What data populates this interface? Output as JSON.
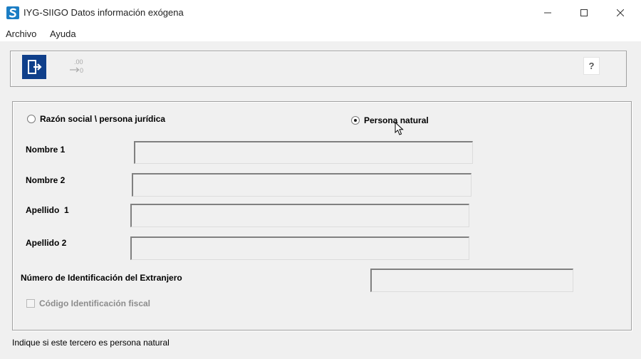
{
  "window": {
    "title": "IYG-SIIGO Datos información exógena"
  },
  "menu": {
    "archivo": "Archivo",
    "ayuda": "Ayuda"
  },
  "toolbar": {
    "help": "?",
    "decimal_top": ".00",
    "decimal_bottom": "0"
  },
  "form": {
    "radio_juridica": "Razón social \\ persona jurídica",
    "radio_natural": "Persona natural",
    "selected_radio": "natural",
    "nombre1_label": "Nombre 1",
    "nombre1_value": "",
    "nombre2_label": "Nombre 2",
    "nombre2_value": "",
    "apellido1_label": "Apellido  1",
    "apellido1_value": "",
    "apellido2_label": "Apellido 2",
    "apellido2_value": "",
    "extranjero_label": "Número de Identificación del Extranjero",
    "extranjero_value": "",
    "codigo_fiscal_label": "Código Identificación fiscal",
    "codigo_fiscal_checked": false,
    "codigo_fiscal_enabled": false
  },
  "status": {
    "text": "Indique si este tercero es persona natural"
  },
  "colors": {
    "app_icon": "#1b7dc4",
    "exit_button": "#0f3f8a",
    "background": "#f0f0f0"
  }
}
